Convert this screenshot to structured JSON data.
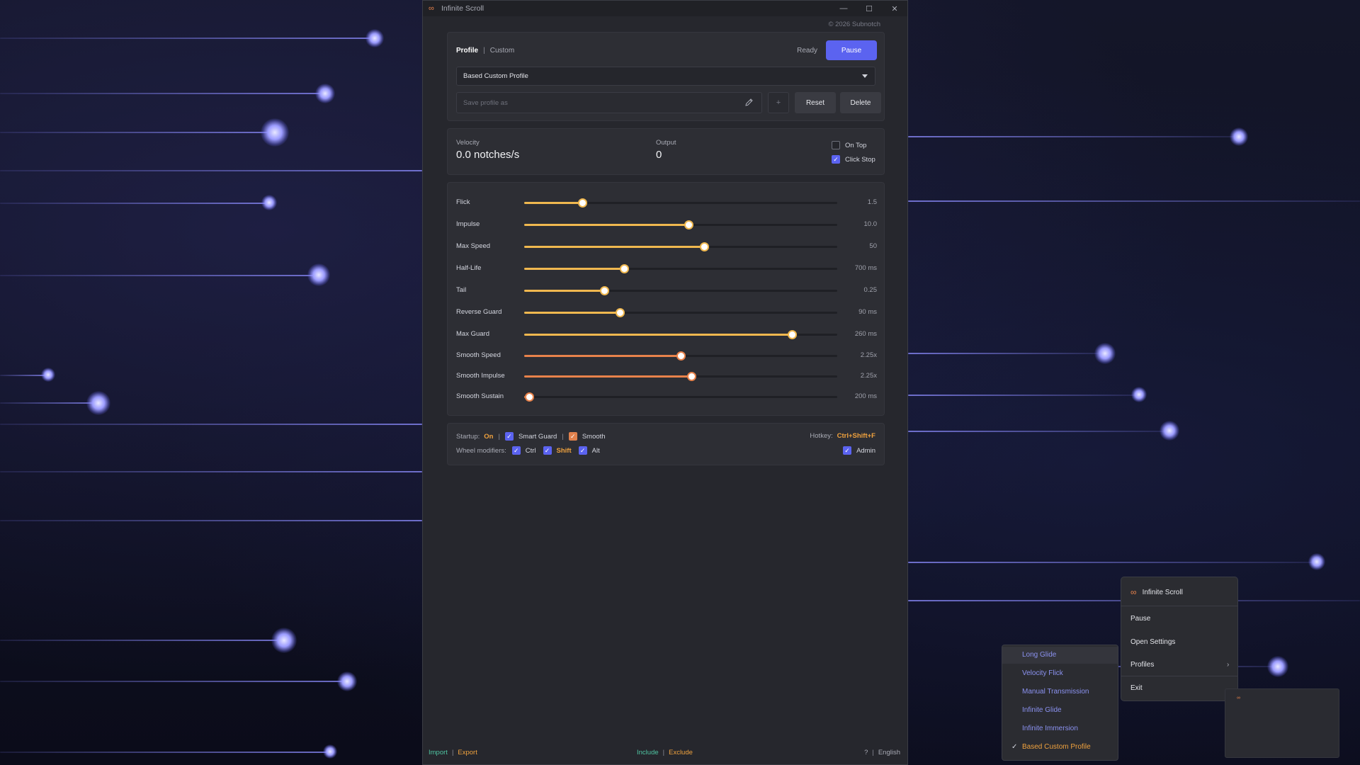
{
  "window": {
    "title": "Infinite Scroll",
    "copyright": "© 2026 Subnotch"
  },
  "profile": {
    "tab_active": "Profile",
    "tab_other": "Custom",
    "status": "Ready",
    "pause_label": "Pause",
    "selected": "Based Custom Profile",
    "save_placeholder": "Save profile as",
    "add_label": "+",
    "reset_label": "Reset",
    "delete_label": "Delete"
  },
  "stats": {
    "velocity_label": "Velocity",
    "velocity_value": "0.0 notches/s",
    "output_label": "Output",
    "output_value": "0",
    "on_top_label": "On Top",
    "on_top_checked": false,
    "click_stop_label": "Click Stop",
    "click_stop_checked": true
  },
  "sliders": [
    {
      "label": "Flick",
      "value": "1.5",
      "fraction": 0.185,
      "color": "#f0b84f"
    },
    {
      "label": "Impulse",
      "value": "10.0",
      "fraction": 0.525,
      "color": "#f0b84f"
    },
    {
      "label": "Max Speed",
      "value": "50",
      "fraction": 0.575,
      "color": "#f0b84f"
    },
    {
      "label": "Half-Life",
      "value": "700 ms",
      "fraction": 0.32,
      "color": "#f0b84f"
    },
    {
      "label": "Tail",
      "value": "0.25",
      "fraction": 0.255,
      "color": "#f0b84f"
    },
    {
      "label": "Reverse Guard",
      "value": "90 ms",
      "fraction": 0.305,
      "color": "#f0b84f"
    },
    {
      "label": "Max Guard",
      "value": "260 ms",
      "fraction": 0.855,
      "color": "#f0b84f"
    },
    {
      "label": "Smooth Speed",
      "value": "2.25x",
      "fraction": 0.5,
      "color": "#e8824b"
    },
    {
      "label": "Smooth Impulse",
      "value": "2.25x",
      "fraction": 0.533,
      "color": "#e8824b"
    },
    {
      "label": "Smooth Sustain",
      "value": "200 ms",
      "fraction": 0.015,
      "color": "#e8824b"
    }
  ],
  "options": {
    "startup_label": "Startup:",
    "startup_value": "On",
    "smart_guard_label": "Smart Guard",
    "smooth_label": "Smooth",
    "hotkey_label": "Hotkey:",
    "hotkey_value": "Ctrl+Shift+F",
    "wheel_label": "Wheel modifiers:",
    "ctrl_label": "Ctrl",
    "shift_label": "Shift",
    "alt_label": "Alt",
    "admin_label": "Admin"
  },
  "footer": {
    "import": "Import",
    "export": "Export",
    "include": "Include",
    "exclude": "Exclude",
    "help": "?",
    "language": "English"
  },
  "tray_menu": {
    "title": "Infinite Scroll",
    "items": [
      "Pause",
      "Open Settings",
      "Profiles",
      "Exit"
    ]
  },
  "profiles_submenu": {
    "items": [
      "Long Glide",
      "Velocity Flick",
      "Manual Transmission",
      "Infinite Glide",
      "Infinite Immersion",
      "Based Custom Profile"
    ],
    "checked": "Based Custom Profile"
  },
  "colors": {
    "accent": "#5b63f0",
    "slider_yellow": "#f0b84f",
    "slider_orange": "#e8824b",
    "link_teal": "#4fc3a1",
    "link_orange": "#f0a23e"
  }
}
